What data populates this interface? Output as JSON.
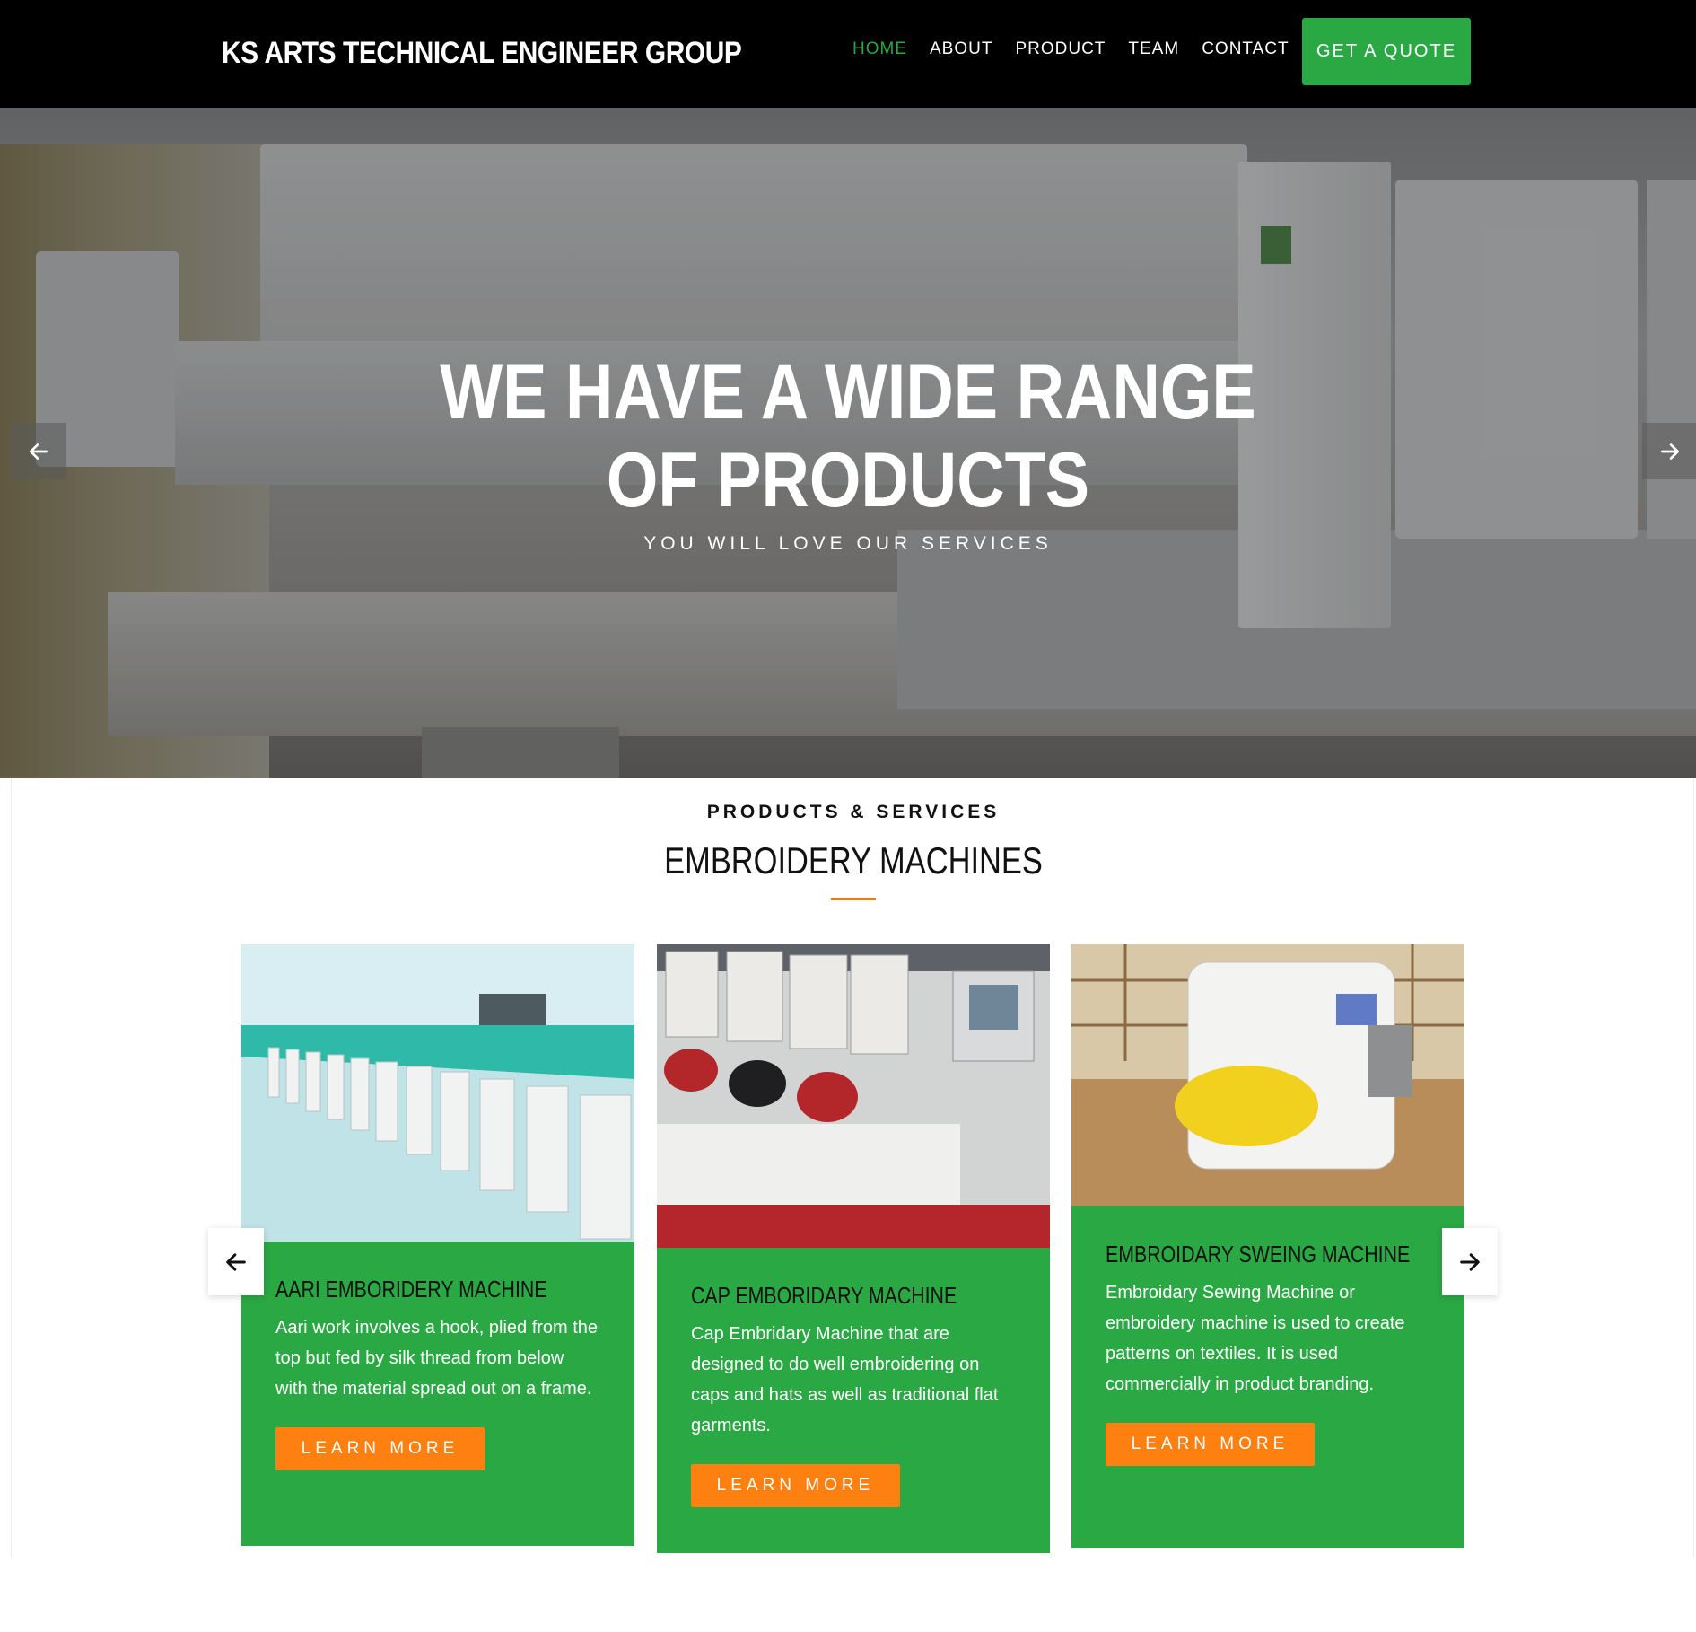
{
  "header": {
    "brand": "KS ARTS TECHNICAL ENGINEER GROUP",
    "nav": [
      {
        "label": "HOME",
        "active": true
      },
      {
        "label": "ABOUT",
        "active": false
      },
      {
        "label": "PRODUCT",
        "active": false
      },
      {
        "label": "TEAM",
        "active": false
      },
      {
        "label": "CONTACT",
        "active": false
      }
    ],
    "cta_label": "GET A QUOTE"
  },
  "hero": {
    "headline_line1": "WE HAVE A WIDE RANGE",
    "headline_line2": "OF PRODUCTS",
    "tagline": "YOU WILL LOVE OUR SERVICES",
    "prev_icon": "arrow-left-icon",
    "next_icon": "arrow-right-icon"
  },
  "products": {
    "kicker": "PRODUCTS & SERVICES",
    "title": "EMBROIDERY MACHINES",
    "cards": [
      {
        "title": "AARI EMBORIDERY MACHINE",
        "text": "Aari work involves a hook, plied from the top but fed by silk thread from below with the material spread out on a frame.",
        "button": "LEARN MORE"
      },
      {
        "title": "CAP EMBORIDARY MACHINE",
        "text": "Cap Embridary Machine that are designed to do well embroidering on caps and hats as well as traditional flat garments.",
        "button": "LEARN MORE"
      },
      {
        "title": "EMBROIDARY SWEING MACHINE",
        "text": "Embroidary Sewing Machine or embroidery machine is used to create patterns on textiles. It is used commercially in product branding.",
        "button": "LEARN MORE"
      }
    ],
    "prev_icon": "arrow-left-icon",
    "next_icon": "arrow-right-icon"
  },
  "colors": {
    "header_bg": "#000000",
    "accent_green": "#2aa844",
    "accent_orange": "#fd8010"
  }
}
